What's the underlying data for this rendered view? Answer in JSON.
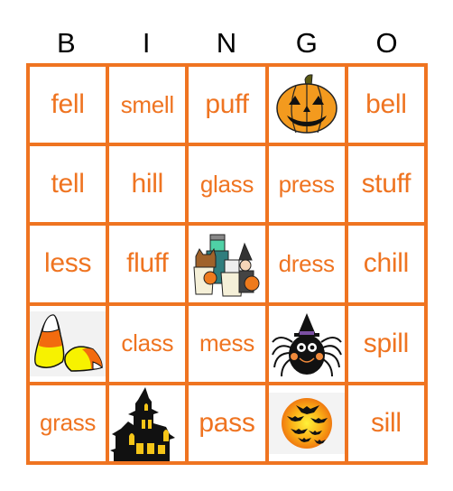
{
  "header": {
    "letters": [
      "B",
      "I",
      "N",
      "G",
      "O"
    ]
  },
  "theme": {
    "accent": "#EF7421",
    "text": "#000000"
  },
  "cells": [
    {
      "type": "word",
      "text": "fell"
    },
    {
      "type": "word",
      "text": "smell"
    },
    {
      "type": "word",
      "text": "puff"
    },
    {
      "type": "image",
      "icon": "jack-o-lantern-icon",
      "description": "Jack-o'-lantern pumpkin"
    },
    {
      "type": "word",
      "text": "bell"
    },
    {
      "type": "word",
      "text": "tell"
    },
    {
      "type": "word",
      "text": "hill"
    },
    {
      "type": "word",
      "text": "glass"
    },
    {
      "type": "word",
      "text": "press"
    },
    {
      "type": "word",
      "text": "stuff"
    },
    {
      "type": "word",
      "text": "less"
    },
    {
      "type": "word",
      "text": "fluff"
    },
    {
      "type": "image",
      "icon": "trick-or-treaters-icon",
      "description": "Kids in Halloween costumes"
    },
    {
      "type": "word",
      "text": "dress"
    },
    {
      "type": "word",
      "text": "chill"
    },
    {
      "type": "image",
      "icon": "candy-corn-icon",
      "description": "Candy corn"
    },
    {
      "type": "word",
      "text": "class"
    },
    {
      "type": "word",
      "text": "mess"
    },
    {
      "type": "image",
      "icon": "spider-witch-hat-icon",
      "description": "Spider wearing witch hat"
    },
    {
      "type": "word",
      "text": "spill"
    },
    {
      "type": "word",
      "text": "grass"
    },
    {
      "type": "image",
      "icon": "haunted-house-icon",
      "description": "Haunted house"
    },
    {
      "type": "word",
      "text": "pass"
    },
    {
      "type": "image",
      "icon": "bats-moon-icon",
      "description": "Bats in front of orange moon"
    },
    {
      "type": "word",
      "text": "sill"
    }
  ]
}
